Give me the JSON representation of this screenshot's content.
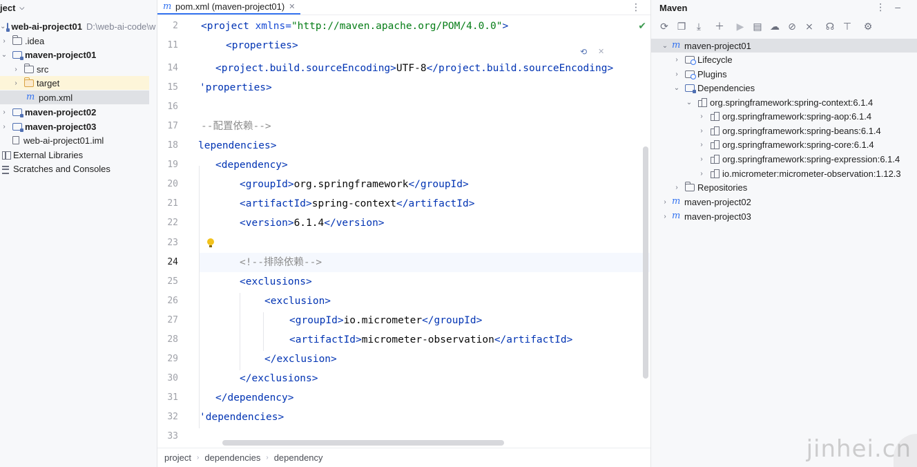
{
  "project_panel": {
    "title": "ject",
    "items": [
      {
        "label": "web-ai-project01",
        "path": "D:\\web-ai-code\\w"
      },
      {
        "label": ".idea"
      },
      {
        "label": "maven-project01"
      },
      {
        "label": "src"
      },
      {
        "label": "target"
      },
      {
        "label": "pom.xml"
      },
      {
        "label": "maven-project02"
      },
      {
        "label": "maven-project03"
      },
      {
        "label": "web-ai-project01.iml"
      },
      {
        "label": "External Libraries"
      },
      {
        "label": "Scratches and Consoles"
      }
    ]
  },
  "editor": {
    "tab_label": "pom.xml (maven-project01)",
    "line_numbers": [
      "2",
      "11",
      "14",
      "15",
      "16",
      "17",
      "18",
      "19",
      "20",
      "21",
      "22",
      "23",
      "24",
      "25",
      "26",
      "27",
      "28",
      "29",
      "30",
      "31",
      "32",
      "33"
    ],
    "current_line": "24",
    "lines": {
      "l2": {
        "open": "<project",
        "attr": " xmlns=",
        "value": "\"http://maven.apache.org/POM/4.0.0\"",
        "close": ">"
      },
      "l11": {
        "tag": "<properties>"
      },
      "l14": {
        "open": "<project.build.sourceEncoding>",
        "text": "UTF-8",
        "close": "</project.build.sourceEncoding>"
      },
      "l15": {
        "tag": "'properties>"
      },
      "l17": {
        "comment": "--配置依赖-->"
      },
      "l18": {
        "tag": "lependencies>"
      },
      "l19": {
        "tag": "<dependency>"
      },
      "l20": {
        "open": "<groupId>",
        "text": "org.springframework",
        "close": "</groupId>"
      },
      "l21": {
        "open": "<artifactId>",
        "text": "spring-context",
        "close": "</artifactId>"
      },
      "l22": {
        "open": "<version>",
        "text": "6.1.4",
        "close": "</version>"
      },
      "l24": {
        "comment": "<!--排除依赖-->"
      },
      "l25": {
        "tag": "<exclusions>"
      },
      "l26": {
        "tag": "<exclusion>"
      },
      "l27": {
        "open": "<groupId>",
        "text": "io.micrometer",
        "close": "</groupId>"
      },
      "l28": {
        "open": "<artifactId>",
        "text": "micrometer-observation",
        "close": "</artifactId>"
      },
      "l29": {
        "tag": "</exclusion>"
      },
      "l30": {
        "tag": "</exclusions>"
      },
      "l31": {
        "tag": "</dependency>"
      },
      "l32": {
        "tag": "'dependencies>"
      }
    },
    "breadcrumb": [
      "project",
      "dependencies",
      "dependency"
    ]
  },
  "maven_panel": {
    "title": "Maven",
    "tree": [
      {
        "label": "maven-project01"
      },
      {
        "label": "Lifecycle"
      },
      {
        "label": "Plugins"
      },
      {
        "label": "Dependencies"
      },
      {
        "label": "org.springframework:spring-context:6.1.4"
      },
      {
        "label": "org.springframework:spring-aop:6.1.4"
      },
      {
        "label": "org.springframework:spring-beans:6.1.4"
      },
      {
        "label": "org.springframework:spring-core:6.1.4"
      },
      {
        "label": "org.springframework:spring-expression:6.1.4"
      },
      {
        "label": "io.micrometer:micrometer-observation:1.12.3"
      },
      {
        "label": "Repositories"
      },
      {
        "label": "maven-project02"
      },
      {
        "label": "maven-project03"
      }
    ]
  },
  "watermark": "jinhei.cn"
}
